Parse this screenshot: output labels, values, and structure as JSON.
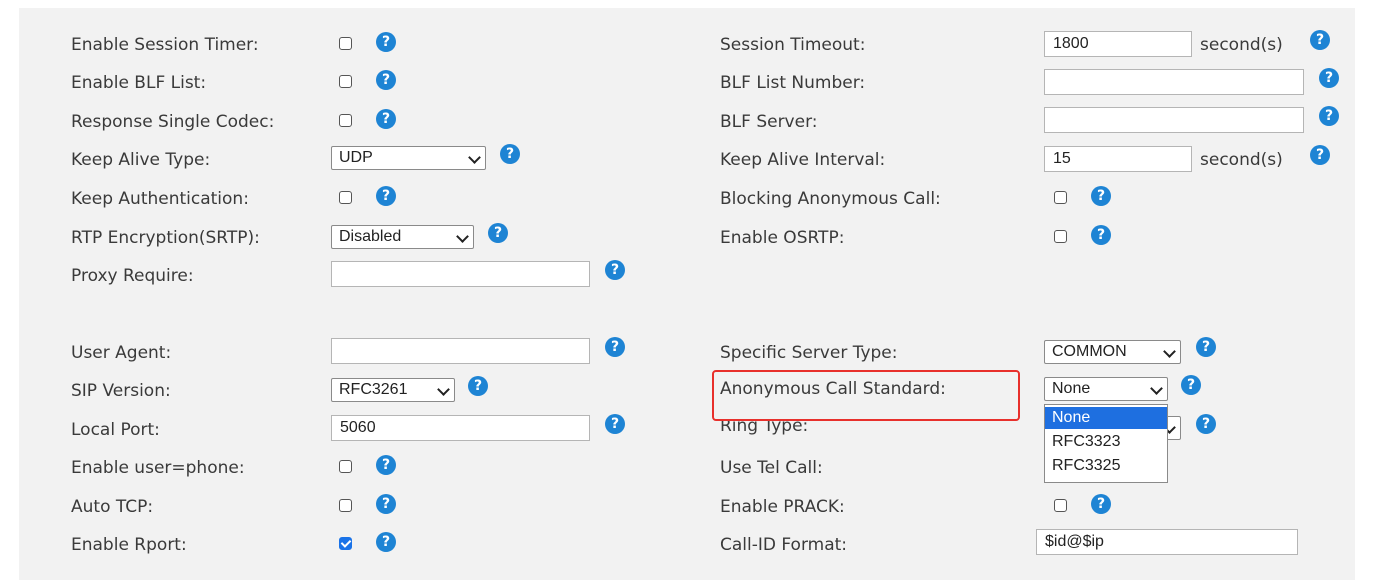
{
  "left": {
    "enable_session_timer": {
      "label": "Enable Session Timer:",
      "checked": false
    },
    "enable_blf_list": {
      "label": "Enable BLF List:",
      "checked": false
    },
    "response_single_codec": {
      "label": "Response Single Codec:",
      "checked": false
    },
    "keep_alive_type": {
      "label": "Keep Alive Type:",
      "value": "UDP"
    },
    "keep_authentication": {
      "label": "Keep Authentication:",
      "checked": false
    },
    "rtp_encryption": {
      "label": "RTP Encryption(SRTP):",
      "value": "Disabled"
    },
    "proxy_require": {
      "label": "Proxy Require:",
      "value": ""
    },
    "user_agent": {
      "label": "User Agent:",
      "value": ""
    },
    "sip_version": {
      "label": "SIP Version:",
      "value": "RFC3261"
    },
    "local_port": {
      "label": "Local Port:",
      "value": "5060"
    },
    "enable_user_phone": {
      "label": "Enable user=phone:",
      "checked": false
    },
    "auto_tcp": {
      "label": "Auto TCP:",
      "checked": false
    },
    "enable_rport": {
      "label": "Enable Rport:",
      "checked": true
    }
  },
  "right": {
    "session_timeout": {
      "label": "Session Timeout:",
      "value": "1800",
      "unit": "second(s)"
    },
    "blf_list_number": {
      "label": "BLF List Number:",
      "value": ""
    },
    "blf_server": {
      "label": "BLF Server:",
      "value": ""
    },
    "keep_alive_interval": {
      "label": "Keep Alive Interval:",
      "value": "15",
      "unit": "second(s)"
    },
    "blocking_anonymous_call": {
      "label": "Blocking Anonymous Call:",
      "checked": false
    },
    "enable_osrtp": {
      "label": "Enable OSRTP:",
      "checked": false
    },
    "specific_server_type": {
      "label": "Specific Server Type:",
      "value": "COMMON"
    },
    "anonymous_call_standard": {
      "label": "Anonymous Call Standard:",
      "value": "None",
      "options": [
        "None",
        "RFC3323",
        "RFC3325"
      ]
    },
    "ring_type": {
      "label": "Ring Type:"
    },
    "use_tel_call": {
      "label": "Use Tel Call:"
    },
    "enable_prack": {
      "label": "Enable PRACK:",
      "checked": false
    },
    "call_id_format": {
      "label": "Call-ID Format:",
      "value": "$id@$ip"
    }
  },
  "help_glyph": "?",
  "colors": {
    "help": "#1e84d4",
    "highlight": "#e8302c",
    "selected_option": "#1e6fe0",
    "panel": "#f2f2f2"
  }
}
